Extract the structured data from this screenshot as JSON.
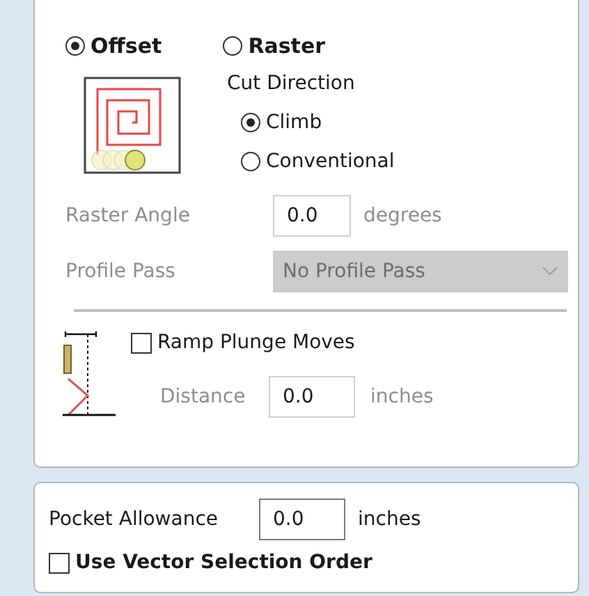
{
  "cut_type": [
    {
      "label": "Offset",
      "selected": true
    },
    {
      "label": "Raster",
      "selected": false
    }
  ],
  "cut_direction": {
    "title": "Cut Direction",
    "options": [
      {
        "label": "Climb",
        "selected": true
      },
      {
        "label": "Conventional",
        "selected": false
      }
    ]
  },
  "raster_angle": {
    "label": "Raster Angle",
    "value": "0.0",
    "unit": "degrees",
    "disabled": true
  },
  "profile_pass": {
    "label": "Profile Pass",
    "value": "No Profile Pass",
    "disabled": true
  },
  "ramp": {
    "label": "Ramp Plunge Moves",
    "checked": false,
    "distance_label": "Distance",
    "distance": "0.0",
    "unit": "inches",
    "disabled": true
  },
  "pocket_allowance": {
    "label": "Pocket Allowance",
    "value": "0.0",
    "unit": "inches"
  },
  "vector_order": {
    "label": "Use Vector Selection Order",
    "checked": false
  }
}
